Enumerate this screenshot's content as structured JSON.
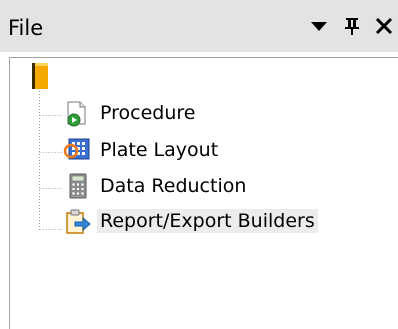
{
  "panel": {
    "title": "File",
    "controls": [
      "dropdown-icon",
      "pin-icon",
      "close-icon"
    ]
  },
  "tree": {
    "root": {
      "icon": "folder-icon"
    },
    "items": [
      {
        "label": "Procedure",
        "icon": "procedure-icon",
        "selected": false
      },
      {
        "label": "Plate Layout",
        "icon": "plate-layout-icon",
        "selected": false
      },
      {
        "label": "Data Reduction",
        "icon": "calculator-icon",
        "selected": false
      },
      {
        "label": "Report/Export Builders",
        "icon": "report-export-icon",
        "selected": true
      }
    ]
  },
  "colors": {
    "titlebar": "#e3e3e3",
    "selection": "#ececec",
    "folder": "#f5a800",
    "tree_line": "#a0a0a0"
  }
}
